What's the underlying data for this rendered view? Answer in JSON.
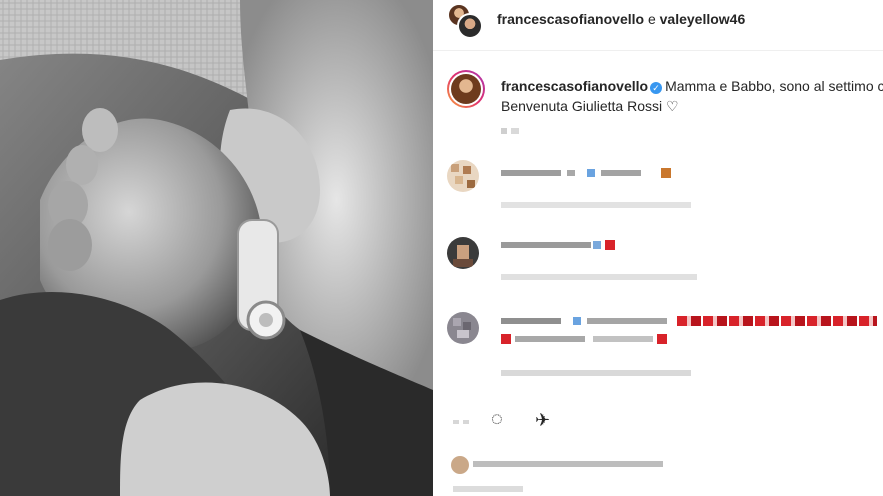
{
  "post": {
    "photo_alt_icon": "baby-feet-photo"
  },
  "header": {
    "user_primary": "francescasofianovello",
    "join_word": "e",
    "user_secondary": "valeyellow46"
  },
  "caption": {
    "username": "francescasofianovello",
    "verified_icon": "verified-badge-icon",
    "text_line1": "Mamma e Babbo, sono al settimo cie",
    "text_line2": "Benvenuta Giulietta Rossi",
    "heart_icon": "heart-outline-icon",
    "heart_glyph": "♡",
    "verified_glyph": "✓"
  },
  "actions": {
    "like_icon": "heart-icon",
    "comment_icon": "comment-icon",
    "share_icon": "share-icon",
    "comment_glyph": "◌",
    "share_glyph": "✈"
  },
  "colors": {
    "verified": "#3897f0",
    "text": "#262626",
    "divider": "#efefef",
    "emoji_red": "#d8232a"
  }
}
